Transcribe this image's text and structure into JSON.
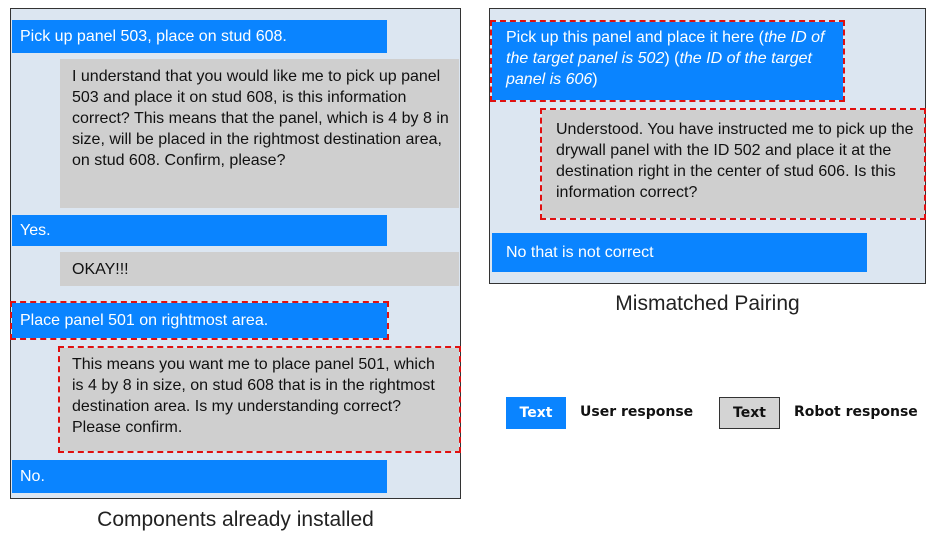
{
  "left": {
    "user1": "Pick up panel 503, place on stud 608.",
    "robot1": "I understand that you would like me to pick up panel 503 and place it on stud 608, is this information correct? This means that the panel, which is 4 by 8 in size, will be placed in the rightmost destination area, on stud 608. Confirm, please?",
    "user2": "Yes.",
    "robot2": "OKAY!!!",
    "user3": "Place panel 501 on rightmost area.",
    "robot3": "This means you want me to place panel 501, which is 4 by 8 in size, on stud 608 that is in the rightmost destination area. Is my understanding correct? Please confirm.",
    "user4": "No.",
    "caption": "Components already installed"
  },
  "right": {
    "user1_a": "Pick up this panel and place it here (",
    "user1_b": "the ID of the target panel is 502",
    "user1_c": ") (",
    "user1_d": "the ID of the target panel is 606",
    "user1_e": ")",
    "robot1": "Understood. You have instructed me to pick up the drywall panel with the ID 502 and place it at the destination right in the center of stud 606. Is this information correct?",
    "user2": "No that is not correct",
    "caption": "Mismatched Pairing"
  },
  "legend": {
    "user_box": "Text",
    "user_label": "User response",
    "robot_box": "Text",
    "robot_label": "Robot response"
  },
  "colors": {
    "user": "#0a84ff",
    "robot": "#cfcfcf",
    "panel": "#dce6f1",
    "highlight": "#e01010"
  }
}
